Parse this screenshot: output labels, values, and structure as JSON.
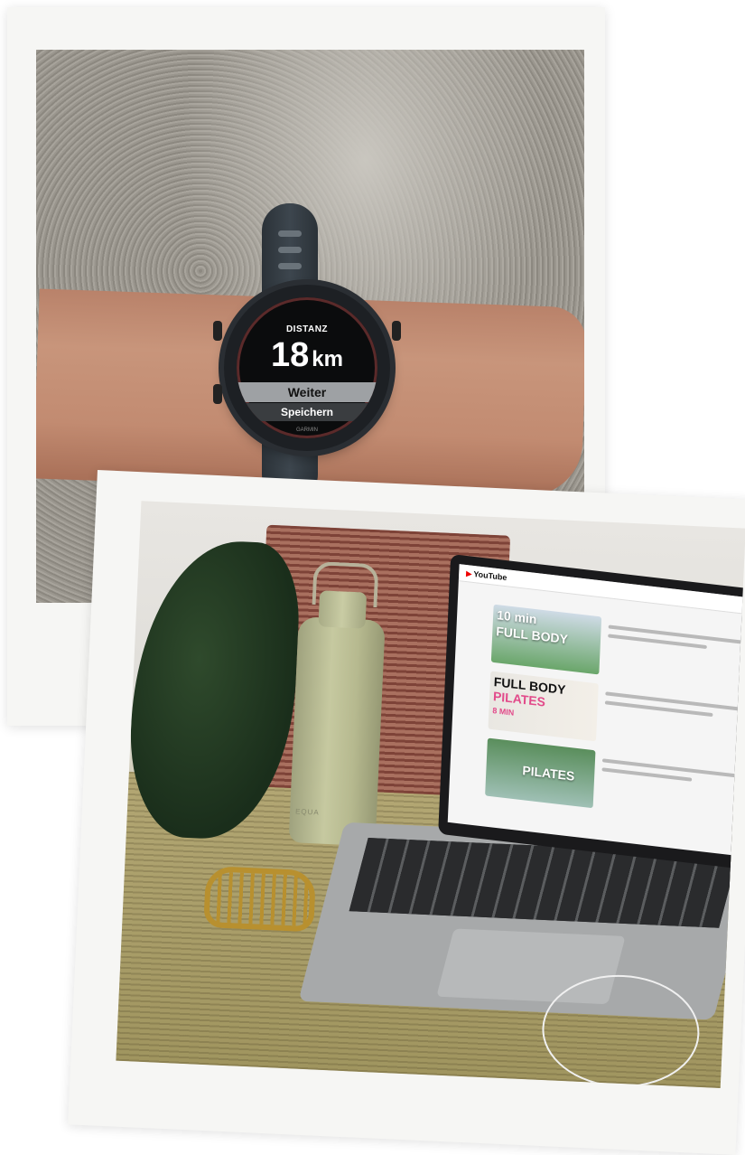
{
  "watch_screen": {
    "label": "DISTANZ",
    "value": "18",
    "unit": "km",
    "menu_primary": "Weiter",
    "menu_secondary": "Speichern",
    "brand": "GARMIN"
  },
  "laptop_screen": {
    "site_logo": "YouTube",
    "thumbnails": [
      {
        "lines": [
          "10 min",
          "FULL BODY"
        ]
      },
      {
        "lines": [
          "FULL BODY",
          "PILATES",
          "8 MIN"
        ]
      },
      {
        "lines": [
          "PILATES"
        ]
      }
    ]
  },
  "bottle": {
    "logo": "EQUA"
  },
  "colors": {
    "frame": "#f6f6f4",
    "watch_body": "#1d2024",
    "bottle": "#c6c9a0",
    "basket": "#a9705f",
    "mat": "#b3a774"
  }
}
